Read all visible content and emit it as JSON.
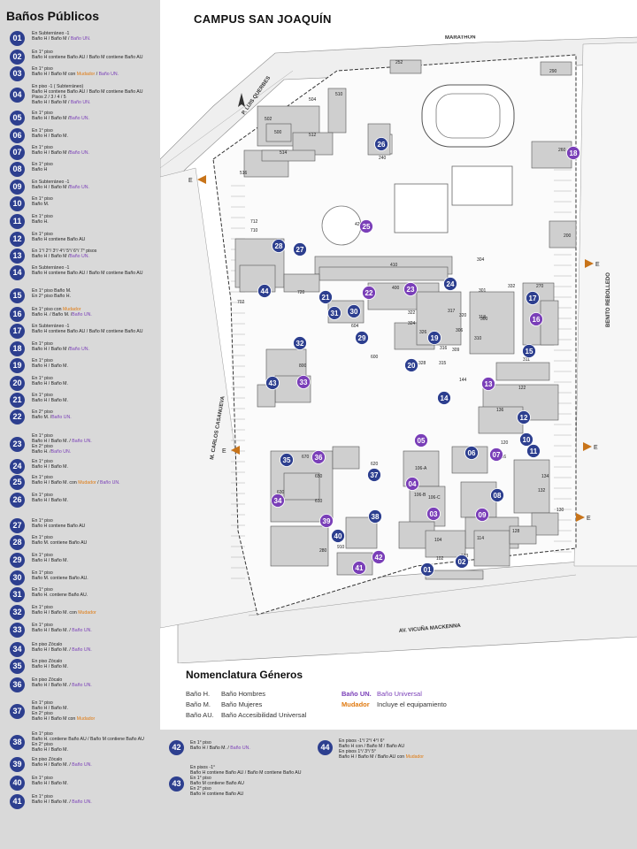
{
  "sidebar": {
    "title": "Baños Públicos",
    "entries": [
      {
        "num": "01",
        "color": "blue",
        "lines": [
          [
            "En Subterráneo -1"
          ],
          [
            "Baño H / Baño M / ",
            {
              "t": "Baño UN.",
              "c": "un"
            }
          ]
        ]
      },
      {
        "num": "02",
        "color": "blue",
        "lines": [
          [
            "En 1° piso"
          ],
          [
            "Baño H contiene Baño AU / Baño M contiene Baño AU"
          ]
        ]
      },
      {
        "num": "03",
        "color": "blue",
        "lines": [
          [
            "En 1° piso"
          ],
          [
            "Baño H / Baño M con ",
            {
              "t": "Mudador",
              "c": "mud"
            },
            " / ",
            {
              "t": "Baño UN.",
              "c": "un"
            }
          ]
        ]
      },
      {
        "num": "04",
        "color": "blue",
        "lines": [
          [
            "En piso -1 ( Subterráneo)"
          ],
          [
            "Baño H contiene Baño AU / Baño M contiene Baño AU"
          ],
          [
            "Pisos 2 / 3 / 4 / 5"
          ],
          [
            "Baño H / Baño M / ",
            {
              "t": "Baño UN.",
              "c": "un"
            }
          ]
        ]
      },
      {
        "num": "05",
        "color": "blue",
        "lines": [
          [
            "En 1° piso"
          ],
          [
            "Baño H / Baño M /",
            {
              "t": "Baño UN.",
              "c": "un"
            }
          ]
        ]
      },
      {
        "num": "06",
        "color": "blue",
        "lines": [
          [
            "En 1° piso"
          ],
          [
            "Baño H / Baño M."
          ]
        ]
      },
      {
        "num": "07",
        "color": "blue",
        "lines": [
          [
            "En 1° piso"
          ],
          [
            "Baño H / Baño M /",
            {
              "t": "Baño UN.",
              "c": "un"
            }
          ]
        ]
      },
      {
        "num": "08",
        "color": "blue",
        "lines": [
          [
            "En 1° piso"
          ],
          [
            "Baño H"
          ]
        ]
      },
      {
        "num": "09",
        "color": "blue",
        "lines": [
          [
            "En Subterráneo -1"
          ],
          [
            "Baño H / Baño M /",
            {
              "t": "Baño UN.",
              "c": "un"
            }
          ]
        ]
      },
      {
        "num": "10",
        "color": "blue",
        "lines": [
          [
            "En 1° piso"
          ],
          [
            "Baño M."
          ]
        ]
      },
      {
        "num": "11",
        "color": "blue",
        "lines": [
          [
            "En 1° piso"
          ],
          [
            "Baño H."
          ]
        ]
      },
      {
        "num": "12",
        "color": "blue",
        "lines": [
          [
            "En 1° piso"
          ],
          [
            "Baño H contiene Baño AU"
          ]
        ]
      },
      {
        "num": "13",
        "color": "blue",
        "lines": [
          [
            "En 1°/ 2°/ 3°/ 4°/ 5°/ 6°/ 7° pisos"
          ],
          [
            "Baño H / Baño M /",
            {
              "t": "Baño UN.",
              "c": "un"
            }
          ]
        ]
      },
      {
        "num": "14",
        "color": "blue",
        "lines": [
          [
            "En Subterráneo -1"
          ],
          [
            "Baño H contiene Baño AU / Baño M contiene Baño AU"
          ]
        ]
      },
      {
        "num": "15",
        "color": "blue",
        "lines": [
          [
            "En 1° piso  Baño M."
          ],
          [
            "En 2° piso  Baño H."
          ]
        ]
      },
      {
        "num": "16",
        "color": "blue",
        "lines": [
          [
            "En 1° piso con ",
            {
              "t": "Mudador",
              "c": "mud"
            }
          ],
          [
            "Baño H. / Baño M. /",
            {
              "t": "Baño UN.",
              "c": "un"
            }
          ]
        ]
      },
      {
        "num": "17",
        "color": "blue",
        "lines": [
          [
            "En Subterráneo -1"
          ],
          [
            "Baño H contiene Baño AU / Baño M contiene Baño AU"
          ]
        ]
      },
      {
        "num": "18",
        "color": "blue",
        "lines": [
          [
            "En 1° piso"
          ],
          [
            "Baño H / Baño M /",
            {
              "t": "Baño UN.",
              "c": "un"
            }
          ]
        ]
      },
      {
        "num": "19",
        "color": "blue",
        "lines": [
          [
            "En 1° piso"
          ],
          [
            "Baño H / Baño M."
          ]
        ]
      },
      {
        "num": "20",
        "color": "blue",
        "lines": [
          [
            "En 1° piso"
          ],
          [
            "Baño H / Baño M."
          ]
        ]
      },
      {
        "num": "21",
        "color": "blue",
        "lines": [
          [
            "En 1° piso"
          ],
          [
            "Baño H / Baño M."
          ]
        ]
      },
      {
        "num": "22",
        "color": "blue",
        "lines": [
          [
            "En 2° piso"
          ],
          [
            "Baño M. /",
            {
              "t": "Baño UN.",
              "c": "un"
            }
          ]
        ]
      },
      {
        "num": "23",
        "color": "blue",
        "lines": [
          [
            "En 1° piso"
          ],
          [
            "Baño H / Baño M. / ",
            {
              "t": "Baño UN.",
              "c": "un"
            }
          ],
          [
            "En 2° piso"
          ],
          [
            "Baño H. /",
            {
              "t": "Baño UN.",
              "c": "un"
            }
          ]
        ]
      },
      {
        "num": "24",
        "color": "blue",
        "lines": [
          [
            "En 1° piso"
          ],
          [
            "Baño H / Baño M."
          ]
        ]
      },
      {
        "num": "25",
        "color": "blue",
        "lines": [
          [
            "En 1° piso"
          ],
          [
            "Baño H / Baño M. con ",
            {
              "t": "Mudador",
              "c": "mud"
            },
            " / ",
            {
              "t": "Baño UN.",
              "c": "un"
            }
          ]
        ]
      },
      {
        "num": "26",
        "color": "blue",
        "lines": [
          [
            "En 1° piso"
          ],
          [
            "Baño H / Baño M."
          ]
        ]
      },
      {
        "num": "27",
        "color": "blue",
        "lines": [
          [
            "En 1° piso"
          ],
          [
            "Baño H contiene Baño AU"
          ]
        ]
      },
      {
        "num": "28",
        "color": "blue",
        "lines": [
          [
            "En 1° piso"
          ],
          [
            "Baño M. contiene Baño AU"
          ]
        ]
      },
      {
        "num": "29",
        "color": "blue",
        "lines": [
          [
            "En 1° piso"
          ],
          [
            "Baño H / Baño M."
          ]
        ]
      },
      {
        "num": "30",
        "color": "blue",
        "lines": [
          [
            "En 1° piso"
          ],
          [
            "Baño M. contiene Baño AU."
          ]
        ]
      },
      {
        "num": "31",
        "color": "blue",
        "lines": [
          [
            "En 1° piso"
          ],
          [
            "Baño H. contiene Baño AU."
          ]
        ]
      },
      {
        "num": "32",
        "color": "blue",
        "lines": [
          [
            "En 1° piso"
          ],
          [
            "Baño H / Baño M. con ",
            {
              "t": "Mudador",
              "c": "mud"
            }
          ]
        ]
      },
      {
        "num": "33",
        "color": "blue",
        "lines": [
          [
            "En 1° piso"
          ],
          [
            "Baño H / Baño M. / ",
            {
              "t": "Baño UN.",
              "c": "un"
            }
          ]
        ]
      },
      {
        "num": "34",
        "color": "blue",
        "lines": [
          [
            "En piso Zócalo"
          ],
          [
            "Baño H / Baño M. / ",
            {
              "t": "Baño UN.",
              "c": "un"
            }
          ]
        ]
      },
      {
        "num": "35",
        "color": "blue",
        "lines": [
          [
            "En piso Zócalo"
          ],
          [
            "Baño H / Baño M."
          ]
        ]
      },
      {
        "num": "36",
        "color": "blue",
        "lines": [
          [
            "En piso Zócalo"
          ],
          [
            "Baño H / Baño M. / ",
            {
              "t": "Baño UN.",
              "c": "un"
            }
          ]
        ]
      },
      {
        "num": "37",
        "color": "blue",
        "lines": [
          [
            "En 1° piso"
          ],
          [
            "Baño H / Baño M."
          ],
          [
            "En 2° piso"
          ],
          [
            "Baño H / Baño M con ",
            {
              "t": "Mudador",
              "c": "mud"
            }
          ]
        ]
      },
      {
        "num": "38",
        "color": "blue",
        "lines": [
          [
            "En 1° piso"
          ],
          [
            "Baño H. contiene Baño AU / Baño M contiene Baño AU"
          ],
          [
            "En 2° piso"
          ],
          [
            "Baño H / Baño M."
          ]
        ]
      },
      {
        "num": "39",
        "color": "blue",
        "lines": [
          [
            "En piso Zócalo"
          ],
          [
            "Baño H / Baño M. / ",
            {
              "t": "Baño UN.",
              "c": "un"
            }
          ]
        ]
      },
      {
        "num": "40",
        "color": "blue",
        "lines": [
          [
            "En 1° piso"
          ],
          [
            "Baño H / Baño M."
          ]
        ]
      },
      {
        "num": "41",
        "color": "blue",
        "lines": [
          [
            "En 1° piso"
          ],
          [
            "Baño H / Baño M. / ",
            {
              "t": "Baño UN.",
              "c": "un"
            }
          ]
        ]
      }
    ]
  },
  "bottom": {
    "entries": [
      {
        "num": "42",
        "color": "blue",
        "lines": [
          [
            "En 1° piso"
          ],
          [
            "Baño H / Baño M. / ",
            {
              "t": "Baño UN.",
              "c": "un"
            }
          ]
        ]
      },
      {
        "num": "43",
        "color": "blue",
        "lines": [
          [
            "En  pisos -1°"
          ],
          [
            "Baño H contiene Baño AU / Baño M contiene Baño AU"
          ],
          [
            "En 1° piso"
          ],
          [
            "Baño M contiene Baño AU"
          ],
          [
            "En 2° piso"
          ],
          [
            "Baño H contiene Baño AU"
          ]
        ]
      },
      {
        "num": "44",
        "color": "blue",
        "lines": [
          [
            "En  pisos -1°/ 2°/ 4°/ 6°"
          ],
          [
            "Baño H con / Baño M / Baño AU"
          ],
          [
            "En  pisos 1°/ 3°/ 5°"
          ],
          [
            "Baño H / Baño M / Baño AU con ",
            {
              "t": "Mudador",
              "c": "mud"
            }
          ]
        ]
      }
    ]
  },
  "map": {
    "title": "CAMPUS SAN JOAQUÍN",
    "streets": {
      "north": "MARATHON",
      "south": "AV. VICUÑA MACKENNA",
      "west": "M. CARLOS CASANUEVA",
      "east": "BENITO REBOLLEDO",
      "northwest": "P. LUIS QUERBES"
    },
    "entrance_label": "E",
    "building_numbers": [
      "252",
      "510",
      "504",
      "502",
      "500",
      "512",
      "514",
      "516",
      "240",
      "290",
      "260",
      "200",
      "420",
      "410",
      "400",
      "712",
      "710",
      "720",
      "702",
      "604",
      "600",
      "800",
      "670",
      "650",
      "610",
      "630",
      "620",
      "106-A",
      "106-B",
      "106-C",
      "104",
      "102",
      "103",
      "114",
      "128",
      "130",
      "134",
      "132",
      "136",
      "122",
      "144",
      "120",
      "116",
      "118",
      "300",
      "301",
      "304",
      "306",
      "309",
      "310",
      "311",
      "315",
      "316",
      "317",
      "320",
      "322",
      "324",
      "326",
      "328",
      "332",
      "270",
      "280",
      "900",
      "910",
      "920"
    ],
    "markers": [
      {
        "num": "01",
        "color": "blue"
      },
      {
        "num": "02",
        "color": "blue"
      },
      {
        "num": "03",
        "color": "purple"
      },
      {
        "num": "04",
        "color": "purple"
      },
      {
        "num": "05",
        "color": "purple"
      },
      {
        "num": "06",
        "color": "blue"
      },
      {
        "num": "07",
        "color": "purple"
      },
      {
        "num": "08",
        "color": "blue"
      },
      {
        "num": "09",
        "color": "purple"
      },
      {
        "num": "10",
        "color": "blue"
      },
      {
        "num": "11",
        "color": "blue"
      },
      {
        "num": "12",
        "color": "blue"
      },
      {
        "num": "13",
        "color": "purple"
      },
      {
        "num": "14",
        "color": "blue"
      },
      {
        "num": "15",
        "color": "blue"
      },
      {
        "num": "16",
        "color": "purple"
      },
      {
        "num": "17",
        "color": "blue"
      },
      {
        "num": "18",
        "color": "purple"
      },
      {
        "num": "19",
        "color": "blue"
      },
      {
        "num": "20",
        "color": "blue"
      },
      {
        "num": "21",
        "color": "blue"
      },
      {
        "num": "22",
        "color": "purple"
      },
      {
        "num": "23",
        "color": "purple"
      },
      {
        "num": "24",
        "color": "blue"
      },
      {
        "num": "25",
        "color": "purple"
      },
      {
        "num": "26",
        "color": "blue"
      },
      {
        "num": "27",
        "color": "blue"
      },
      {
        "num": "28",
        "color": "blue"
      },
      {
        "num": "29",
        "color": "blue"
      },
      {
        "num": "30",
        "color": "blue"
      },
      {
        "num": "31",
        "color": "blue"
      },
      {
        "num": "32",
        "color": "blue"
      },
      {
        "num": "33",
        "color": "purple"
      },
      {
        "num": "34",
        "color": "purple"
      },
      {
        "num": "35",
        "color": "blue"
      },
      {
        "num": "36",
        "color": "purple"
      },
      {
        "num": "37",
        "color": "blue"
      },
      {
        "num": "38",
        "color": "blue"
      },
      {
        "num": "39",
        "color": "purple"
      },
      {
        "num": "40",
        "color": "blue"
      },
      {
        "num": "41",
        "color": "purple"
      },
      {
        "num": "42",
        "color": "purple"
      },
      {
        "num": "43",
        "color": "blue"
      },
      {
        "num": "44",
        "color": "blue"
      }
    ]
  },
  "legend": {
    "title": "Nomenclatura Géneros",
    "items": [
      {
        "code": "Baño H.",
        "desc": "Baño Hombres"
      },
      {
        "code": "Baño M.",
        "desc": "Baño Mujeres"
      },
      {
        "code": "Baño AU.",
        "desc": "Baño Accesibilidad Universal"
      }
    ],
    "special": [
      {
        "code": "Baño UN.",
        "desc": "Baño Universal",
        "color": "#7a3fb8"
      },
      {
        "code": "Mudador",
        "desc": "Incluye el equipamiento",
        "color": "#e07a10"
      }
    ]
  },
  "colors": {
    "blue": "#2d3f8f",
    "purple": "#7a3fb8",
    "orange": "#e07a10",
    "panel": "#d9d9d9"
  }
}
